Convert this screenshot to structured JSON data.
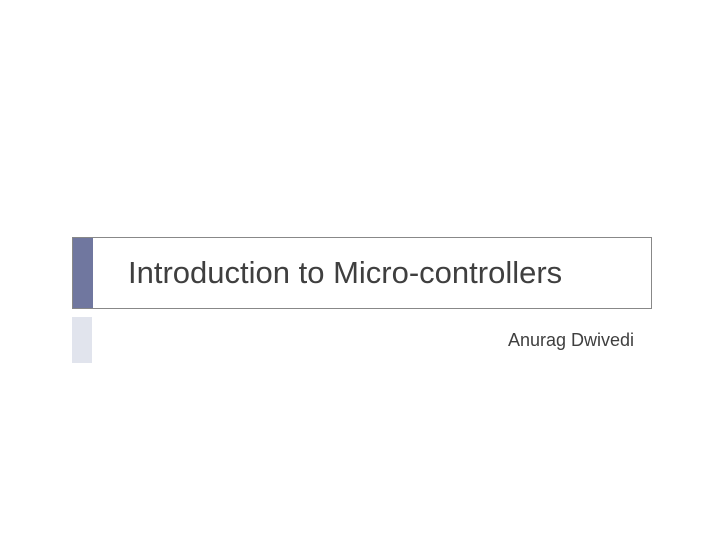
{
  "slide": {
    "title": "Introduction to Micro-controllers",
    "author": "Anurag Dwivedi"
  }
}
